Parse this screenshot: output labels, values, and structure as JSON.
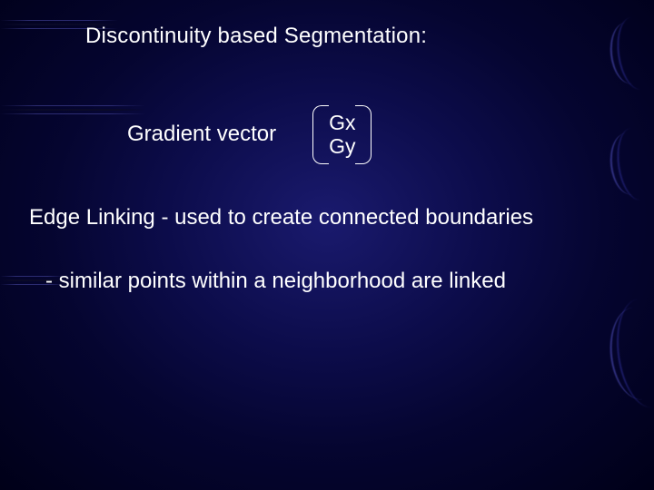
{
  "title": "Discontinuity based Segmentation:",
  "gradient": {
    "label": "Gradient vector",
    "vector": {
      "row0": "Gx",
      "row1": "Gy"
    }
  },
  "edge_linking": "Edge Linking - used to create connected boundaries",
  "similar_points": "- similar points within a neighborhood are linked"
}
